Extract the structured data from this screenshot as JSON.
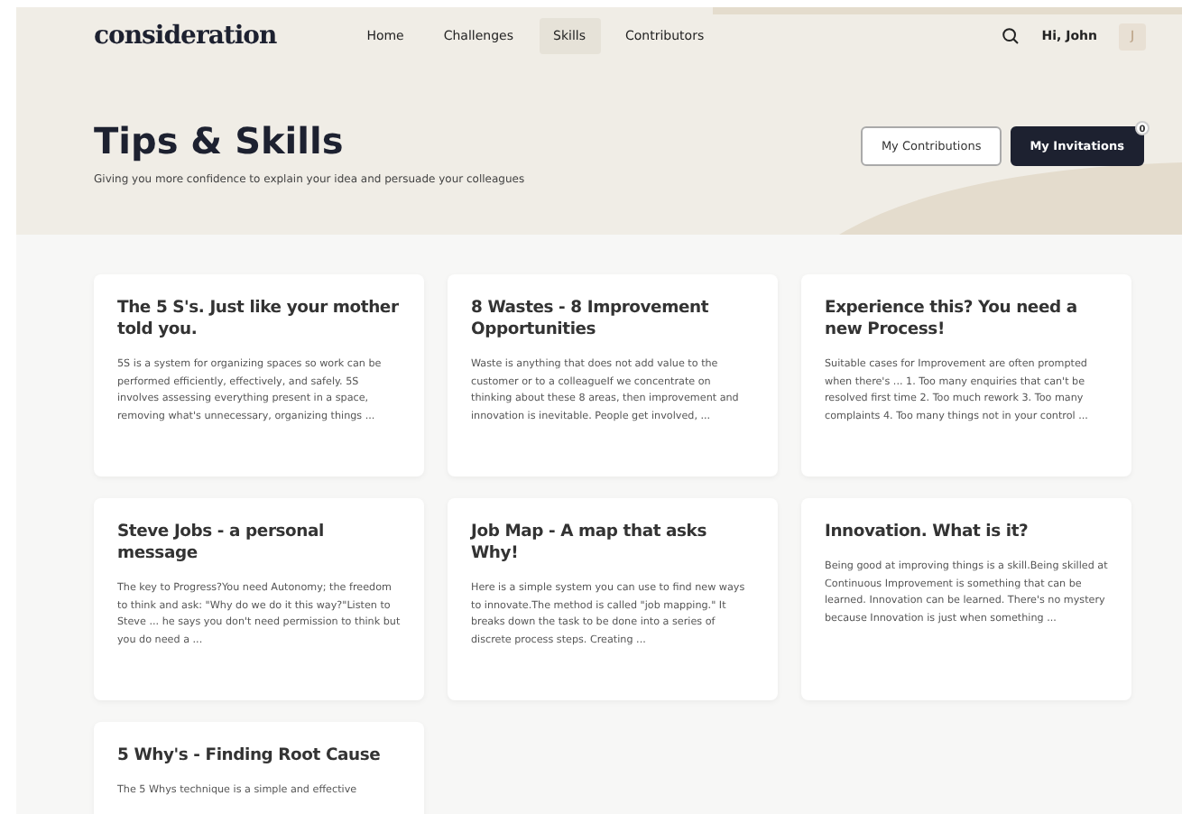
{
  "logo": "consideration",
  "nav": [
    {
      "label": "Home",
      "selected": false
    },
    {
      "label": "Challenges",
      "selected": false
    },
    {
      "label": "Skills",
      "selected": true
    },
    {
      "label": "Contributors",
      "selected": false
    }
  ],
  "user": {
    "greeting": "Hi, John",
    "initial": "J"
  },
  "hero": {
    "title": "Tips & Skills",
    "subtitle": "Giving you more confidence to explain your idea and persuade your colleagues",
    "buttons": [
      {
        "label": "My Contributions",
        "kind": "outline"
      },
      {
        "label": "My Invitations",
        "kind": "primary",
        "badge": "0"
      }
    ]
  },
  "cards": [
    {
      "title": "The 5 S's. Just like your mother told you.",
      "text": "5S is a system for organizing spaces so work can be performed efficiently, effectively, and safely. 5S involves assessing everything present in a space, removing what's unnecessary, organizing things ..."
    },
    {
      "title": "8 Wastes - 8 Improvement Opportunities",
      "text": "Waste is anything that does not add value to the customer or to a colleagueIf we concentrate on thinking about these 8 areas, then improvement and innovation is inevitable. People get involved, ..."
    },
    {
      "title": "Experience this? You need a new Process!",
      "text": "Suitable cases for Improvement are often prompted when there's ... 1. Too many enquiries that can't be resolved first time 2. Too much rework 3. Too many complaints 4. Too many things not in your control ..."
    },
    {
      "title": "Steve Jobs - a personal message",
      "text": "The key to Progress?You need Autonomy; the freedom to think and ask:  \"Why do we do it this way?\"Listen to Steve ... he says you don't need permission to think but you do need a ..."
    },
    {
      "title": "Job Map - A map that asks Why!",
      "text": "Here is a simple system you can use to find new ways to innovate.The method is called \"job mapping.\" It breaks down the task to be done into a series of discrete process steps. Creating ..."
    },
    {
      "title": "Innovation. What is it?",
      "text": "Being good at improving things is a skill.Being skilled at Continuous Improvement is something that can be learned. Innovation can be learned. There's no mystery because Innovation is just when something ..."
    },
    {
      "title": "5 Why's - Finding Root Cause",
      "text": "The 5 Whys technique is a simple and effective"
    }
  ]
}
